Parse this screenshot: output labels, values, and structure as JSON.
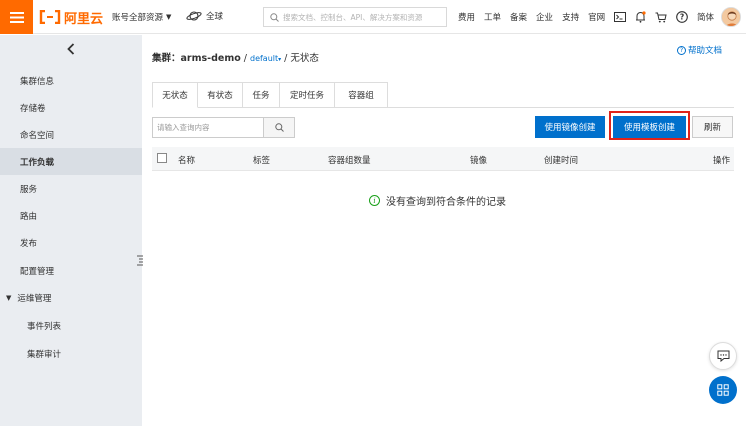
{
  "topbar": {
    "logo_text": "阿里云",
    "account_label": "账号全部资源",
    "region_label": "全球",
    "search_placeholder": "搜索文档、控制台、API、解决方案和资源",
    "nav_links": [
      "费用",
      "工单",
      "备案",
      "企业",
      "支持",
      "官网"
    ],
    "lang_label": "简体",
    "brand_color": "#ff6a00"
  },
  "sidebar": {
    "items": [
      {
        "label": "集群信息"
      },
      {
        "label": "存储卷"
      },
      {
        "label": "命名空间"
      },
      {
        "label": "工作负载",
        "active": true
      },
      {
        "label": "服务"
      },
      {
        "label": "路由"
      },
      {
        "label": "发布"
      },
      {
        "label": "配置管理"
      },
      {
        "label": "运维管理",
        "expanded": true
      },
      {
        "label": "事件列表"
      },
      {
        "label": "集群审计"
      }
    ]
  },
  "breadcrumb": {
    "prefix": "集群：",
    "cluster": "arms-demo",
    "sep1": "/",
    "namespace": "default",
    "sep2": "/",
    "current": "无状态"
  },
  "help_link": "帮助文档",
  "tabs": [
    "无状态",
    "有状态",
    "任务",
    "定时任务",
    "容器组"
  ],
  "query": {
    "placeholder": "请输入查询内容"
  },
  "buttons": {
    "create_from_image": "使用镜像创建",
    "create_from_template": "使用模板创建",
    "refresh": "刷新"
  },
  "table": {
    "columns": [
      "名称",
      "标签",
      "容器组数量",
      "镜像",
      "创建时间",
      "操作"
    ],
    "empty_text": "没有查询到符合条件的记录"
  },
  "colors": {
    "primary": "#0070cc",
    "highlight": "#e0231a",
    "sidebar_bg": "#eaedf1"
  }
}
